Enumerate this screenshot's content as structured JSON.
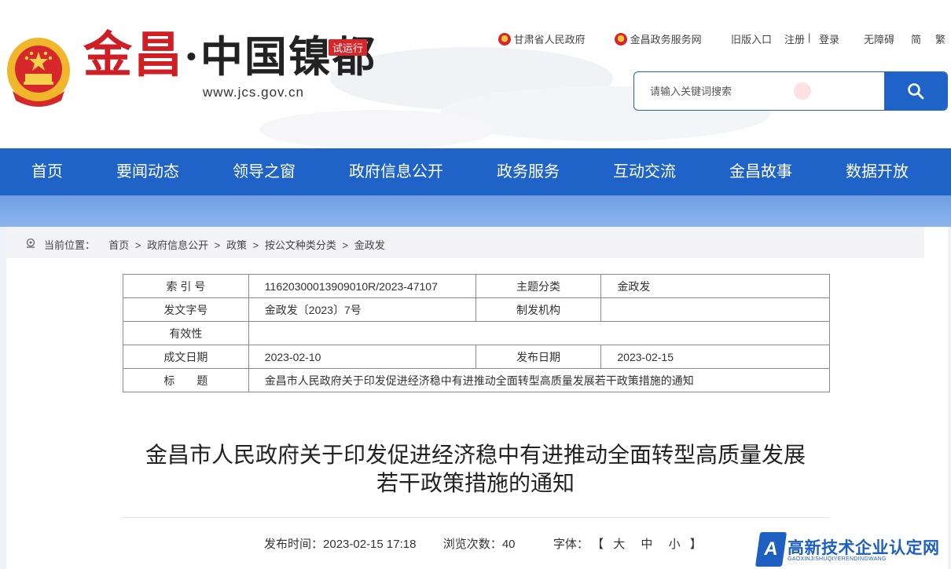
{
  "header": {
    "logo": {
      "char1": "金",
      "char2": "昌",
      "dot": "·",
      "rest": "中国镍都"
    },
    "trial_badge": "试运行",
    "domain": "www.jcs.gov.cn",
    "top_links": {
      "gansu": "甘肃省人民政府",
      "service_net": "金昌政务服务网",
      "old_version": "旧版入口",
      "register": "注册",
      "divider": "|",
      "login": "登录",
      "accessibility": "无障碍",
      "simplified": "简",
      "traditional": "繁"
    },
    "search": {
      "placeholder": "请输入关键词搜索",
      "value": ""
    }
  },
  "nav": {
    "items": [
      {
        "label": "首页"
      },
      {
        "label": "要闻动态"
      },
      {
        "label": "领导之窗"
      },
      {
        "label": "政府信息公开"
      },
      {
        "label": "政务服务"
      },
      {
        "label": "互动交流"
      },
      {
        "label": "金昌故事"
      },
      {
        "label": "数据开放"
      }
    ]
  },
  "breadcrumb": {
    "prefix": "当前位置：",
    "separator": ">",
    "items": [
      "首页",
      "政府信息公开",
      "政策",
      "按公文种类分类",
      "金政发"
    ]
  },
  "info_table": {
    "index_label": "索 引 号",
    "index_value": "11620300013909010R/2023-47107",
    "topic_label": "主题分类",
    "topic_value": "金政发",
    "doc_no_label": "发文字号",
    "doc_no_value": "金政发〔2023〕7号",
    "issuer_label": "制发机构",
    "issuer_value": "",
    "validity_label": "有效性",
    "validity_value": "",
    "created_label": "成文日期",
    "created_value": "2023-02-10",
    "published_label": "发布日期",
    "published_value": "2023-02-15",
    "title_label": "标　　题",
    "title_value": "金昌市人民政府关于印发促进经济稳中有进推动全面转型高质量发展若干政策措施的通知"
  },
  "article": {
    "title_line1": "金昌市人民政府关于印发促进经济稳中有进推动全面转型高质量发展",
    "title_line2": "若干政策措施的通知",
    "publish_label": "发布时间：",
    "publish_time": "2023-02-15 17:18",
    "views_label": "浏览次数：",
    "views": "40",
    "font_label": "字体：",
    "bracket_open": "【",
    "font_large": "大",
    "font_medium": "中",
    "font_small": "小",
    "bracket_close": "】"
  },
  "watermark": {
    "badge": "A",
    "text": "高新技术企业认定网",
    "sub": "GAOXINJISHUQIYERENDINGWANG"
  },
  "colors": {
    "nav_blue": "#1f63c9",
    "brand_red": "#cf1f25"
  }
}
